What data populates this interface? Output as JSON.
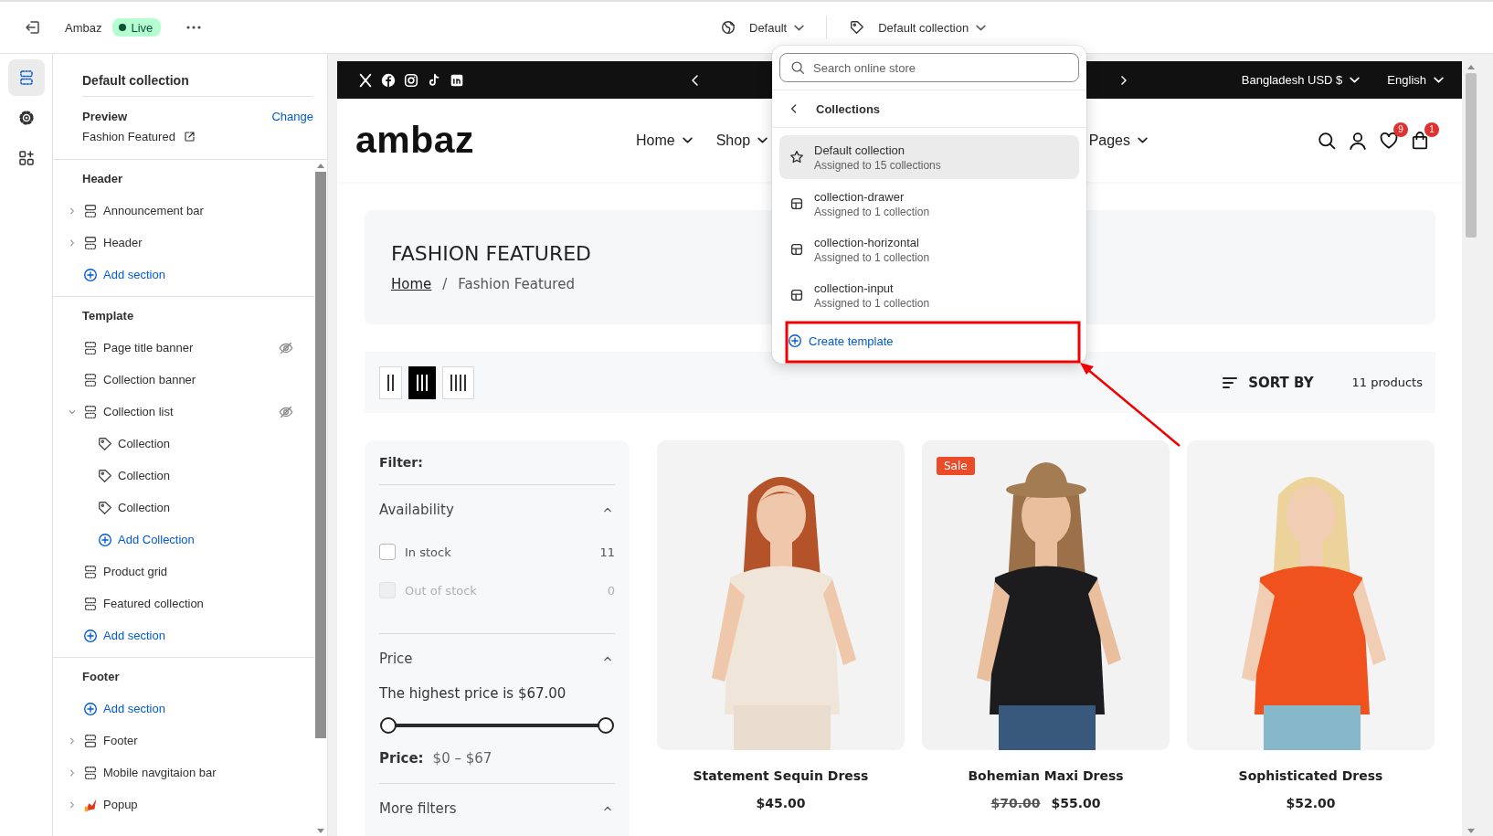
{
  "topbar": {
    "store_name": "Ambaz",
    "status": {
      "label": "Live",
      "kind": "live"
    },
    "theme": "Default",
    "template": "Default collection"
  },
  "rail": [
    {
      "kind": "sections",
      "selected": true
    },
    {
      "kind": "settings",
      "selected": false
    },
    {
      "kind": "apps",
      "selected": false
    }
  ],
  "sidebar": {
    "title": "Default collection",
    "preview": {
      "label": "Preview",
      "action": "Change",
      "page": "Fashion Featured"
    },
    "groups": [
      {
        "title": "Header",
        "items": [
          {
            "kind": "header-section",
            "label": "Announcement bar",
            "expanded": false,
            "hidden": false
          },
          {
            "kind": "header-section",
            "label": "Header",
            "expanded": false,
            "hidden": false
          },
          {
            "kind": "add",
            "label": "Add section"
          }
        ]
      },
      {
        "title": "Template",
        "items": [
          {
            "kind": "section",
            "label": "Page title banner",
            "hidden": true
          },
          {
            "kind": "section",
            "label": "Collection banner",
            "hidden": false
          },
          {
            "kind": "section",
            "label": "Collection list",
            "expanded": true,
            "hidden": true,
            "children": [
              {
                "kind": "block",
                "label": "Collection"
              },
              {
                "kind": "block",
                "label": "Collection"
              },
              {
                "kind": "block",
                "label": "Collection"
              },
              {
                "kind": "add",
                "label": "Add Collection"
              }
            ]
          },
          {
            "kind": "section",
            "label": "Product grid",
            "hidden": false
          },
          {
            "kind": "section",
            "label": "Featured collection",
            "hidden": false
          },
          {
            "kind": "add",
            "label": "Add section"
          }
        ]
      },
      {
        "title": "Footer",
        "items": [
          {
            "kind": "add",
            "label": "Add section"
          },
          {
            "kind": "footer-section",
            "label": "Footer",
            "expanded": false,
            "hidden": false
          },
          {
            "kind": "section",
            "label": "Mobile navgitaion bar",
            "expanded": false,
            "hidden": false
          },
          {
            "kind": "app",
            "label": "Popup",
            "expanded": false,
            "hidden": false
          }
        ]
      }
    ]
  },
  "store": {
    "announcement": {
      "currency": "Bangladesh USD $",
      "language": "English"
    },
    "logo": "ambaz",
    "nav": [
      {
        "label": "Home",
        "has_menu": true
      },
      {
        "label": "Shop",
        "has_menu": true
      },
      {
        "label": "Pages",
        "has_menu": true
      }
    ],
    "badges": {
      "wishlist": "9",
      "cart": "1"
    },
    "banner": {
      "title": "FASHION FEATURED",
      "separator": "/",
      "breadcrumb": [
        {
          "label": "Home",
          "link": true
        },
        {
          "label": "Fashion Featured",
          "link": false
        }
      ]
    },
    "toolbar": {
      "layouts": [
        {
          "kind": "two",
          "selected": false
        },
        {
          "kind": "three",
          "selected": true
        },
        {
          "kind": "four",
          "selected": false
        }
      ],
      "sort": "SORT BY",
      "count": "11 products"
    },
    "filter": {
      "title": "Filter:",
      "groups": [
        {
          "kind": "checklist",
          "title": "Availability",
          "expanded": true,
          "options": [
            {
              "label": "In stock",
              "count": "11",
              "checked": false,
              "disabled": false
            },
            {
              "label": "Out of stock",
              "count": "0",
              "checked": false,
              "disabled": true
            }
          ]
        },
        {
          "kind": "range",
          "title": "Price",
          "expanded": true,
          "note": "The highest price is $67.00",
          "thumbs": [
            {
              "level": 0
            },
            {
              "level": 1
            }
          ],
          "label": "Price:",
          "value": "$0 – $67"
        },
        {
          "kind": "more",
          "title": "More filters",
          "expanded": true
        }
      ]
    },
    "products": [
      {
        "title": "Statement Sequin Dress",
        "price": "$45.00"
      },
      {
        "badge": "Sale",
        "title": "Bohemian Maxi Dress",
        "old_price": "$70.00",
        "price": "$55.00"
      },
      {
        "title": "Sophisticated Dress",
        "price": "$52.00"
      }
    ]
  },
  "template_menu": {
    "search_placeholder": "Search online store",
    "title": "Collections",
    "items": [
      {
        "kind": "default",
        "name": "Default collection",
        "note": "Assigned to 15 collections",
        "selected": true
      },
      {
        "kind": "template",
        "name": "collection-drawer",
        "note": "Assigned to 1 collection",
        "selected": false
      },
      {
        "kind": "template",
        "name": "collection-horizontal",
        "note": "Assigned to 1 collection",
        "selected": false
      },
      {
        "kind": "template",
        "name": "collection-input",
        "note": "Assigned to 1 collection",
        "selected": false
      }
    ],
    "create": "Create template"
  }
}
